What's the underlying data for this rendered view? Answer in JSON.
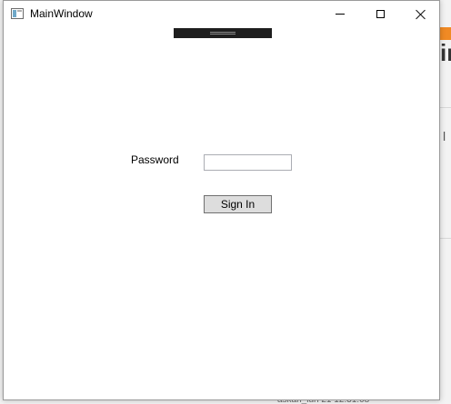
{
  "window": {
    "title": "MainWindow",
    "icon": "app-window-icon"
  },
  "caption_buttons": {
    "minimize_icon": "minimize-icon",
    "maximize_icon": "maximize-icon",
    "close_icon": "close-icon"
  },
  "form": {
    "password_label": "Password",
    "password_value": "",
    "signin_label": "Sign In"
  },
  "background": {
    "big_text_fragment": "in",
    "side_char": "l",
    "footer_fragment": "askan_lun 21 12:31:08",
    "accent_color": "#f08a24"
  }
}
